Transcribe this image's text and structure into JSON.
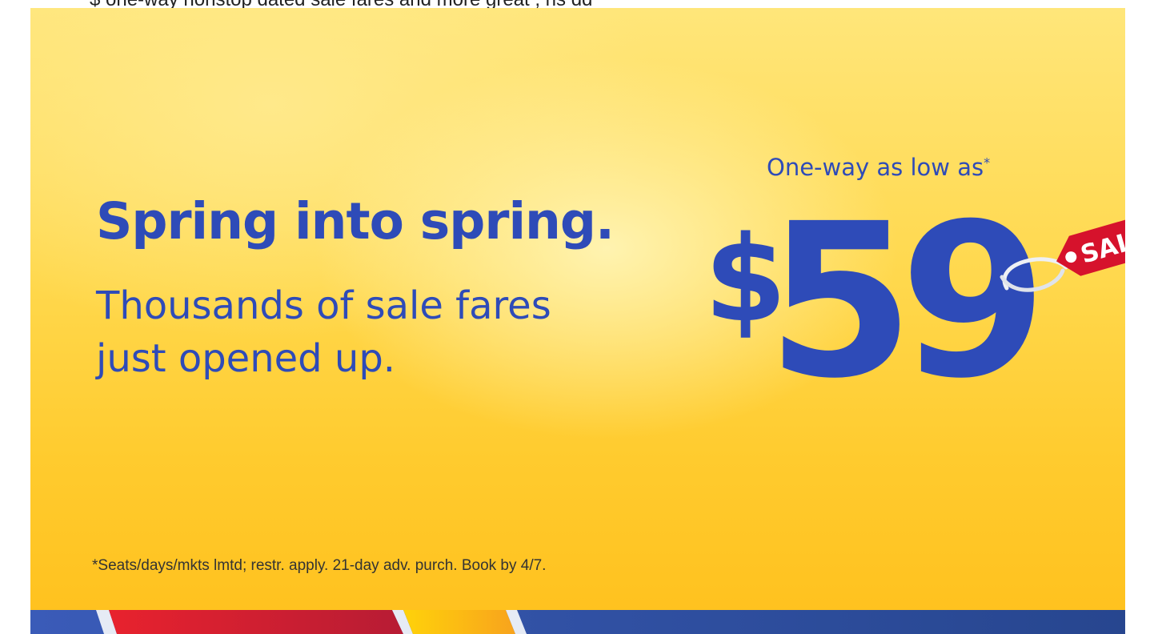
{
  "page": {
    "top_strip_text": "$ one-way nonstop dated sale fares and more great , hs dd"
  },
  "banner": {
    "headline": "Spring into spring.",
    "subline_1": "Thousands of sale fares",
    "subline_2": "just opened up.",
    "price_caption": "One-way as low as",
    "price_caption_mark": "*",
    "price_dollar": "$",
    "price_amount": "59",
    "sale_tag": "SALE",
    "fineprint": "*Seats/days/mkts lmtd; restr. apply. 21-day adv. purch. Book by 4/7."
  },
  "colors": {
    "brand_blue": "#2e4bb8",
    "sale_red": "#d6122c",
    "background_yellow": "#ffd84d",
    "stripe_red": "#e21d2c",
    "stripe_yellow": "#ffc20e",
    "stripe_blue": "#304cb2"
  }
}
